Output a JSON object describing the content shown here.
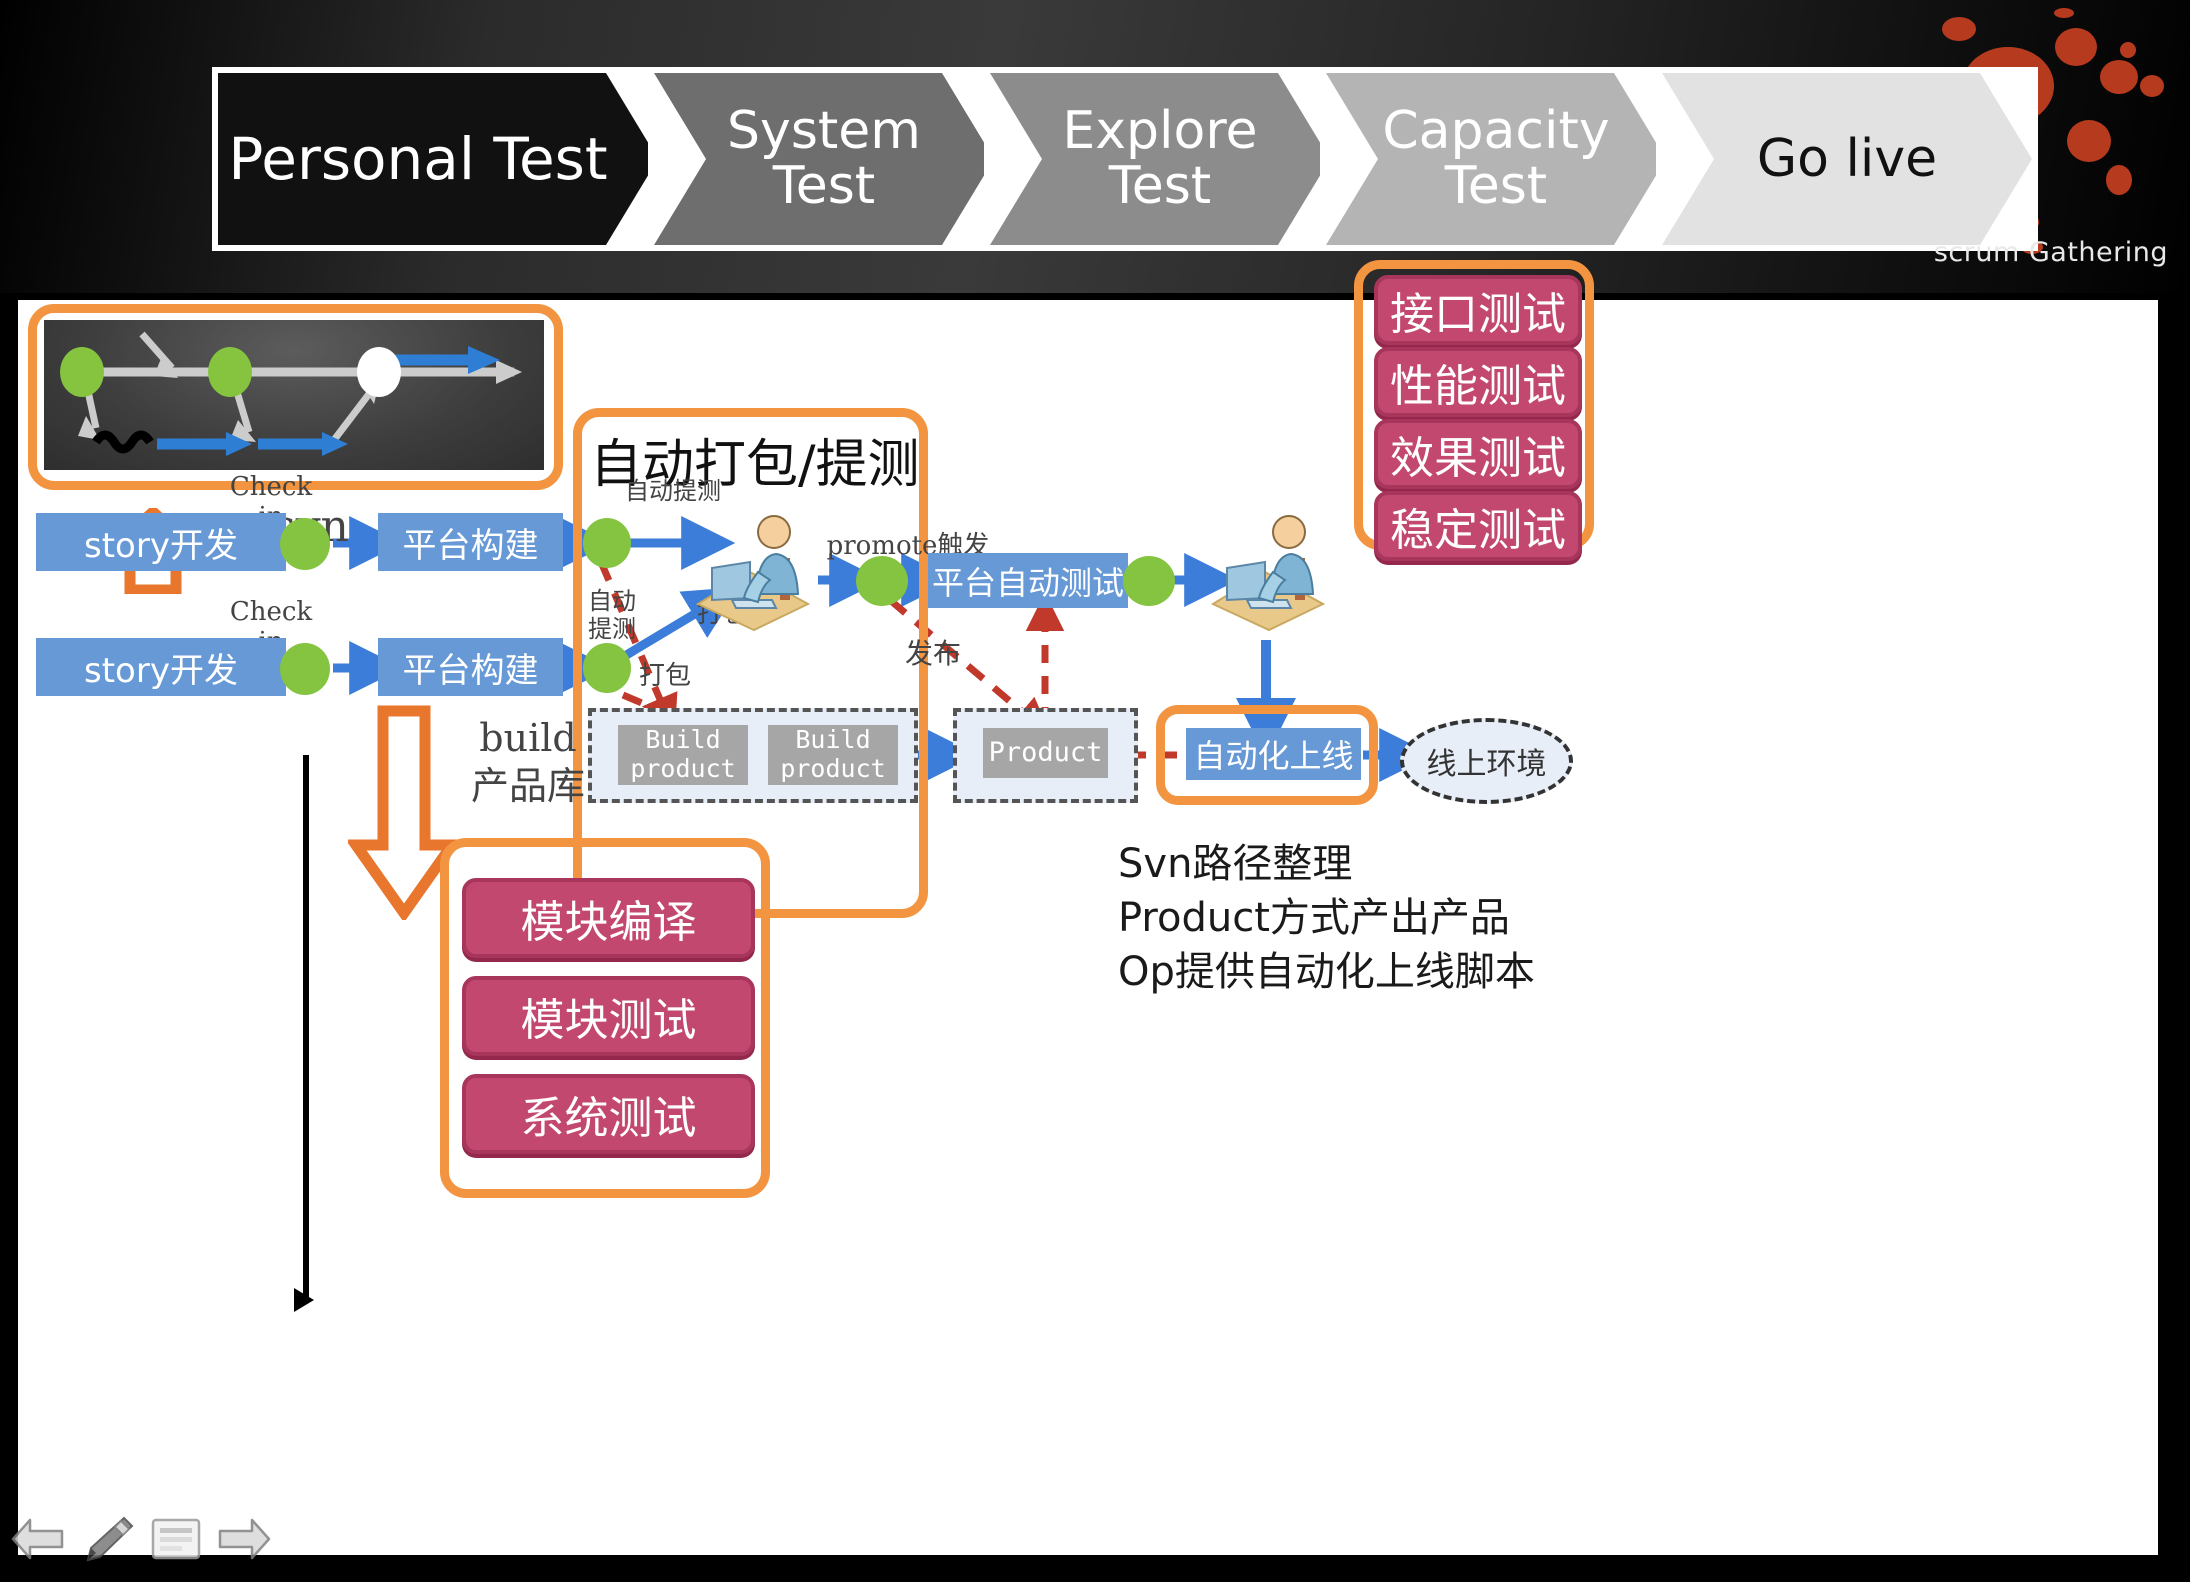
{
  "banner": {
    "stages": [
      {
        "label": "Personal Test",
        "bg": "#111111"
      },
      {
        "label": "System\nTest",
        "bg": "#6e6e6e"
      },
      {
        "label": "Explore\nTest",
        "bg": "#8c8c8c"
      },
      {
        "label": "Capacity\nTest",
        "bg": "#b4b4b4"
      },
      {
        "label": "Go live",
        "bg": "#e2e2e2"
      }
    ],
    "brand": "scrum Gathering",
    "accent_color": "#b63a1e"
  },
  "slide": {
    "title_auto_package": "自动打包/提测",
    "svn_label": "svn",
    "build_repo_label": "build\n产品库",
    "story_boxes": [
      "story开发",
      "story开发"
    ],
    "checkin_labels": [
      "Check\nin",
      "Check\nin"
    ],
    "platform_build_boxes": [
      "平台构建",
      "平台构建"
    ],
    "auto_submit_top": "自动提测",
    "auto_submit_bottom": "自动\n提测",
    "package_labels": [
      "打包",
      "打包"
    ],
    "promote_label": "promote触发",
    "release_label": "发布",
    "platform_auto_test": "平台自动测试",
    "build_products": [
      "Build\nproduct",
      "Build\nproduct"
    ],
    "product_box": "Product",
    "auto_deploy": "自动化上线",
    "online_env": "线上环境",
    "test_types": [
      "接口测试",
      "性能测试",
      "效果测试",
      "稳定测试"
    ],
    "module_steps": [
      "模块编译",
      "模块测试",
      "系统测试"
    ],
    "notes": "Svn路径整理\nProduct方式产出产品\nOp提供自动化上线脚本",
    "colors": {
      "orange_frame": "#f29440",
      "blue_box": "#6699d6",
      "pink_box": "#c3486f",
      "green_dot": "#85c441",
      "red_dashed": "#c0392b",
      "blue_arrow": "#3b7dd8"
    }
  },
  "navigation": {
    "items": [
      {
        "name": "previous",
        "icon": "left-arrow-icon"
      },
      {
        "name": "pen",
        "icon": "pen-icon"
      },
      {
        "name": "menu",
        "icon": "menu-icon"
      },
      {
        "name": "next",
        "icon": "right-arrow-icon"
      }
    ]
  }
}
